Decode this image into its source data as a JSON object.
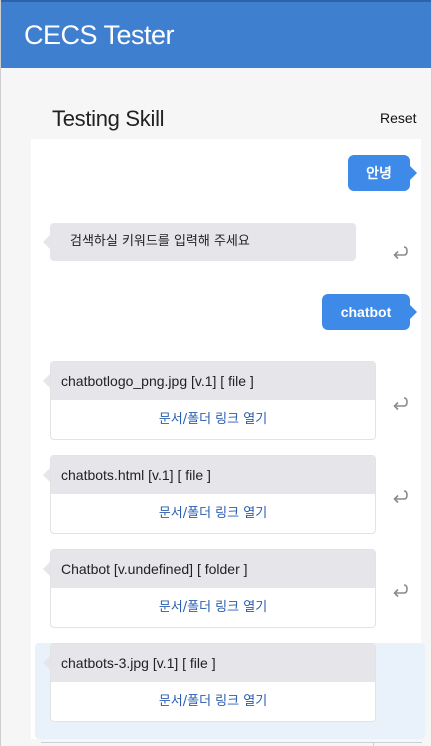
{
  "app": {
    "title": "CECS Tester"
  },
  "panel": {
    "title": "Testing Skill",
    "reset_label": "Reset"
  },
  "messages": {
    "user_1": "안녕",
    "bot_1": "검색하실 키워드를 입력해 주세요",
    "user_2": "chatbot"
  },
  "results": [
    {
      "title": "chatbotlogo_png.jpg [v.1] [ file ]",
      "link_label": "문서/폴더 링크 열기"
    },
    {
      "title": "chatbots.html [v.1] [ file ]",
      "link_label": "문서/폴더 링크 열기"
    },
    {
      "title": "Chatbot [v.undefined] [ folder ]",
      "link_label": "문서/폴더 링크 열기"
    },
    {
      "title": "chatbots-3.jpg [v.1] [ file ]",
      "link_label": "문서/폴더 링크 열기"
    }
  ],
  "icons": {
    "reply": "reply-arrow-icon"
  },
  "colors": {
    "header": "#3f7fcf",
    "user_bubble": "#3d8ae8",
    "bot_bubble": "#e6e6ea",
    "link": "#2a5db0",
    "highlight": "#e9f1fb"
  }
}
